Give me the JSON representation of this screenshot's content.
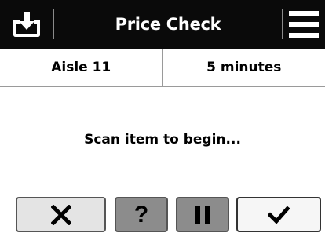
{
  "header": {
    "title": "Price Check",
    "download_icon": "download-tray-icon",
    "menu_icon": "hamburger-menu-icon"
  },
  "info": {
    "aisle": "Aisle 11",
    "duration": "5 minutes"
  },
  "status": {
    "message": "Scan item to begin..."
  },
  "actions": {
    "cancel_icon": "x-icon",
    "help_label": "?",
    "pause_icon": "pause-icon",
    "confirm_icon": "checkmark-icon"
  },
  "colors": {
    "titlebar_bg": "#0a0a0a",
    "button_gray": "#8c8c8c",
    "button_light": "#e4e4e4"
  }
}
